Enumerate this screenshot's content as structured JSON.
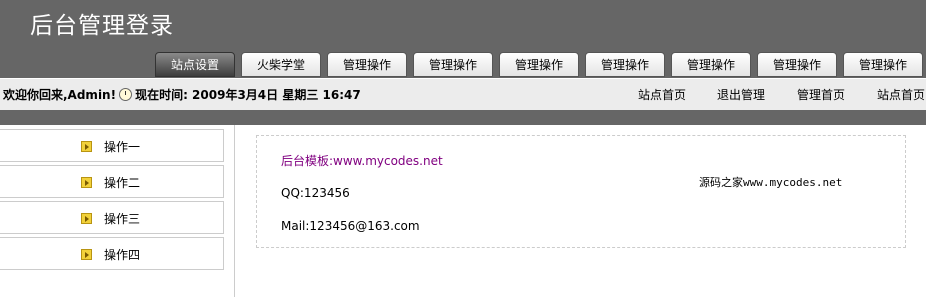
{
  "header": {
    "title": "后台管理登录",
    "tabs": [
      "站点设置",
      "火柴学堂",
      "管理操作",
      "管理操作",
      "管理操作",
      "管理操作",
      "管理操作",
      "管理操作",
      "管理操作"
    ],
    "active_tab": 0
  },
  "infobar": {
    "welcome": "欢迎你回来,Admin!",
    "time_label": "现在时间: 2009年3月4日 星期三 16:47",
    "links": [
      "站点首页",
      "退出管理",
      "管理首页",
      "站点首页"
    ]
  },
  "sidebar": {
    "items": [
      {
        "label": "操作一",
        "icon": "arrow-icon"
      },
      {
        "label": "操作二",
        "icon": "arrow-icon"
      },
      {
        "label": "操作三",
        "icon": "arrow-icon"
      },
      {
        "label": "操作四",
        "icon": "arrow-icon"
      }
    ]
  },
  "content": {
    "site": "后台模板:www.mycodes.net",
    "qq": "QQ:123456",
    "mail": "Mail:123456@163.com",
    "watermark": "源码之家www.mycodes.net"
  },
  "colors": {
    "header_bg": "#666666",
    "infobar_bg": "#ececec",
    "link_purple": "#800080"
  }
}
